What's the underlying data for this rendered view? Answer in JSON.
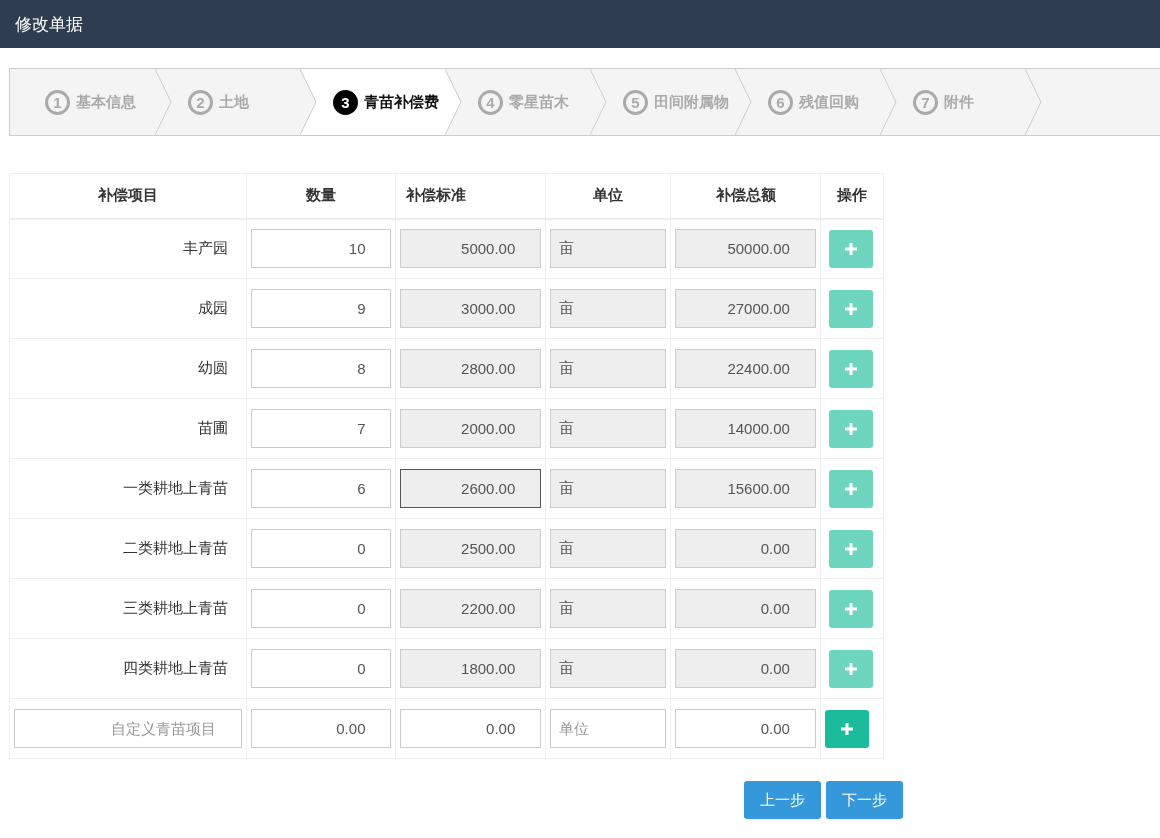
{
  "header": {
    "title": "修改单据"
  },
  "steps": [
    {
      "number": "1",
      "label": "基本信息",
      "selected": false
    },
    {
      "number": "2",
      "label": "土地",
      "selected": false
    },
    {
      "number": "3",
      "label": "青苗补偿费",
      "selected": true
    },
    {
      "number": "4",
      "label": "零星苗木",
      "selected": false
    },
    {
      "number": "5",
      "label": "田间附属物",
      "selected": false
    },
    {
      "number": "6",
      "label": "残值回购",
      "selected": false
    },
    {
      "number": "7",
      "label": "附件",
      "selected": false
    }
  ],
  "table": {
    "columns": [
      {
        "label": "补偿项目"
      },
      {
        "label": "数量"
      },
      {
        "label": "补偿标准"
      },
      {
        "label": "单位"
      },
      {
        "label": "补偿总额"
      },
      {
        "label": "操作"
      }
    ],
    "rows": [
      {
        "item": "丰产园",
        "quantity": "10",
        "standard": "5000.00",
        "unit": "亩",
        "total": "50000.00",
        "focused": false,
        "add_disabled": true
      },
      {
        "item": "成园",
        "quantity": "9",
        "standard": "3000.00",
        "unit": "亩",
        "total": "27000.00",
        "focused": false,
        "add_disabled": true
      },
      {
        "item": "幼圆",
        "quantity": "8",
        "standard": "2800.00",
        "unit": "亩",
        "total": "22400.00",
        "focused": false,
        "add_disabled": true
      },
      {
        "item": "苗圃",
        "quantity": "7",
        "standard": "2000.00",
        "unit": "亩",
        "total": "14000.00",
        "focused": false,
        "add_disabled": true
      },
      {
        "item": "一类耕地上青苗",
        "quantity": "6",
        "standard": "2600.00",
        "unit": "亩",
        "total": "15600.00",
        "focused": true,
        "add_disabled": true
      },
      {
        "item": "二类耕地上青苗",
        "quantity": "0",
        "standard": "2500.00",
        "unit": "亩",
        "total": "0.00",
        "focused": false,
        "add_disabled": true
      },
      {
        "item": "三类耕地上青苗",
        "quantity": "0",
        "standard": "2200.00",
        "unit": "亩",
        "total": "0.00",
        "focused": false,
        "add_disabled": true
      },
      {
        "item": "四类耕地上青苗",
        "quantity": "0",
        "standard": "1800.00",
        "unit": "亩",
        "total": "0.00",
        "focused": false,
        "add_disabled": true
      }
    ],
    "custom_row": {
      "item_placeholder": "自定义青苗项目",
      "quantity": "0.00",
      "standard": "0.00",
      "unit_placeholder": "单位",
      "total": "0.00",
      "add_disabled": false
    }
  },
  "buttons": [
    {
      "label": "上一步"
    },
    {
      "label": "下一步"
    }
  ]
}
